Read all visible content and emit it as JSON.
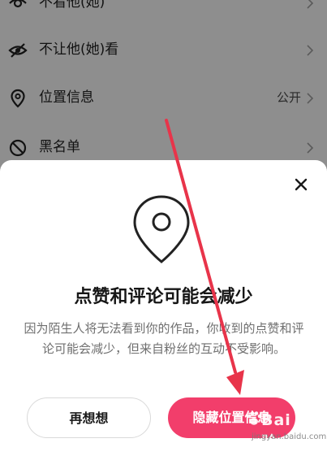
{
  "background_list": {
    "items": [
      {
        "label": "不看他(她)",
        "icon": "block-view-icon",
        "value": ""
      },
      {
        "label": "不让他(她)看",
        "icon": "eye-slash-icon",
        "value": ""
      },
      {
        "label": "位置信息",
        "icon": "location-pin-icon",
        "value": "公开"
      },
      {
        "label": "黑名单",
        "icon": "prohibited-icon",
        "value": ""
      }
    ]
  },
  "dialog": {
    "title": "点赞和评论可能会减少",
    "description": "因为陌生人将无法看到你的作品，你收到的点赞和评论可能会减少，但来自粉丝的互动不受影响。",
    "secondary_button": "再想想",
    "primary_button": "隐藏位置信息",
    "close_icon": "close-icon",
    "illustration_icon": "location-pin-icon"
  },
  "colors": {
    "overlay": "#8e8e8e",
    "primary_button": "#f23e6b",
    "annotation_arrow": "#e8344a"
  },
  "watermark": {
    "text": "Bai 经验",
    "url": "jingyan.baidu.com"
  }
}
